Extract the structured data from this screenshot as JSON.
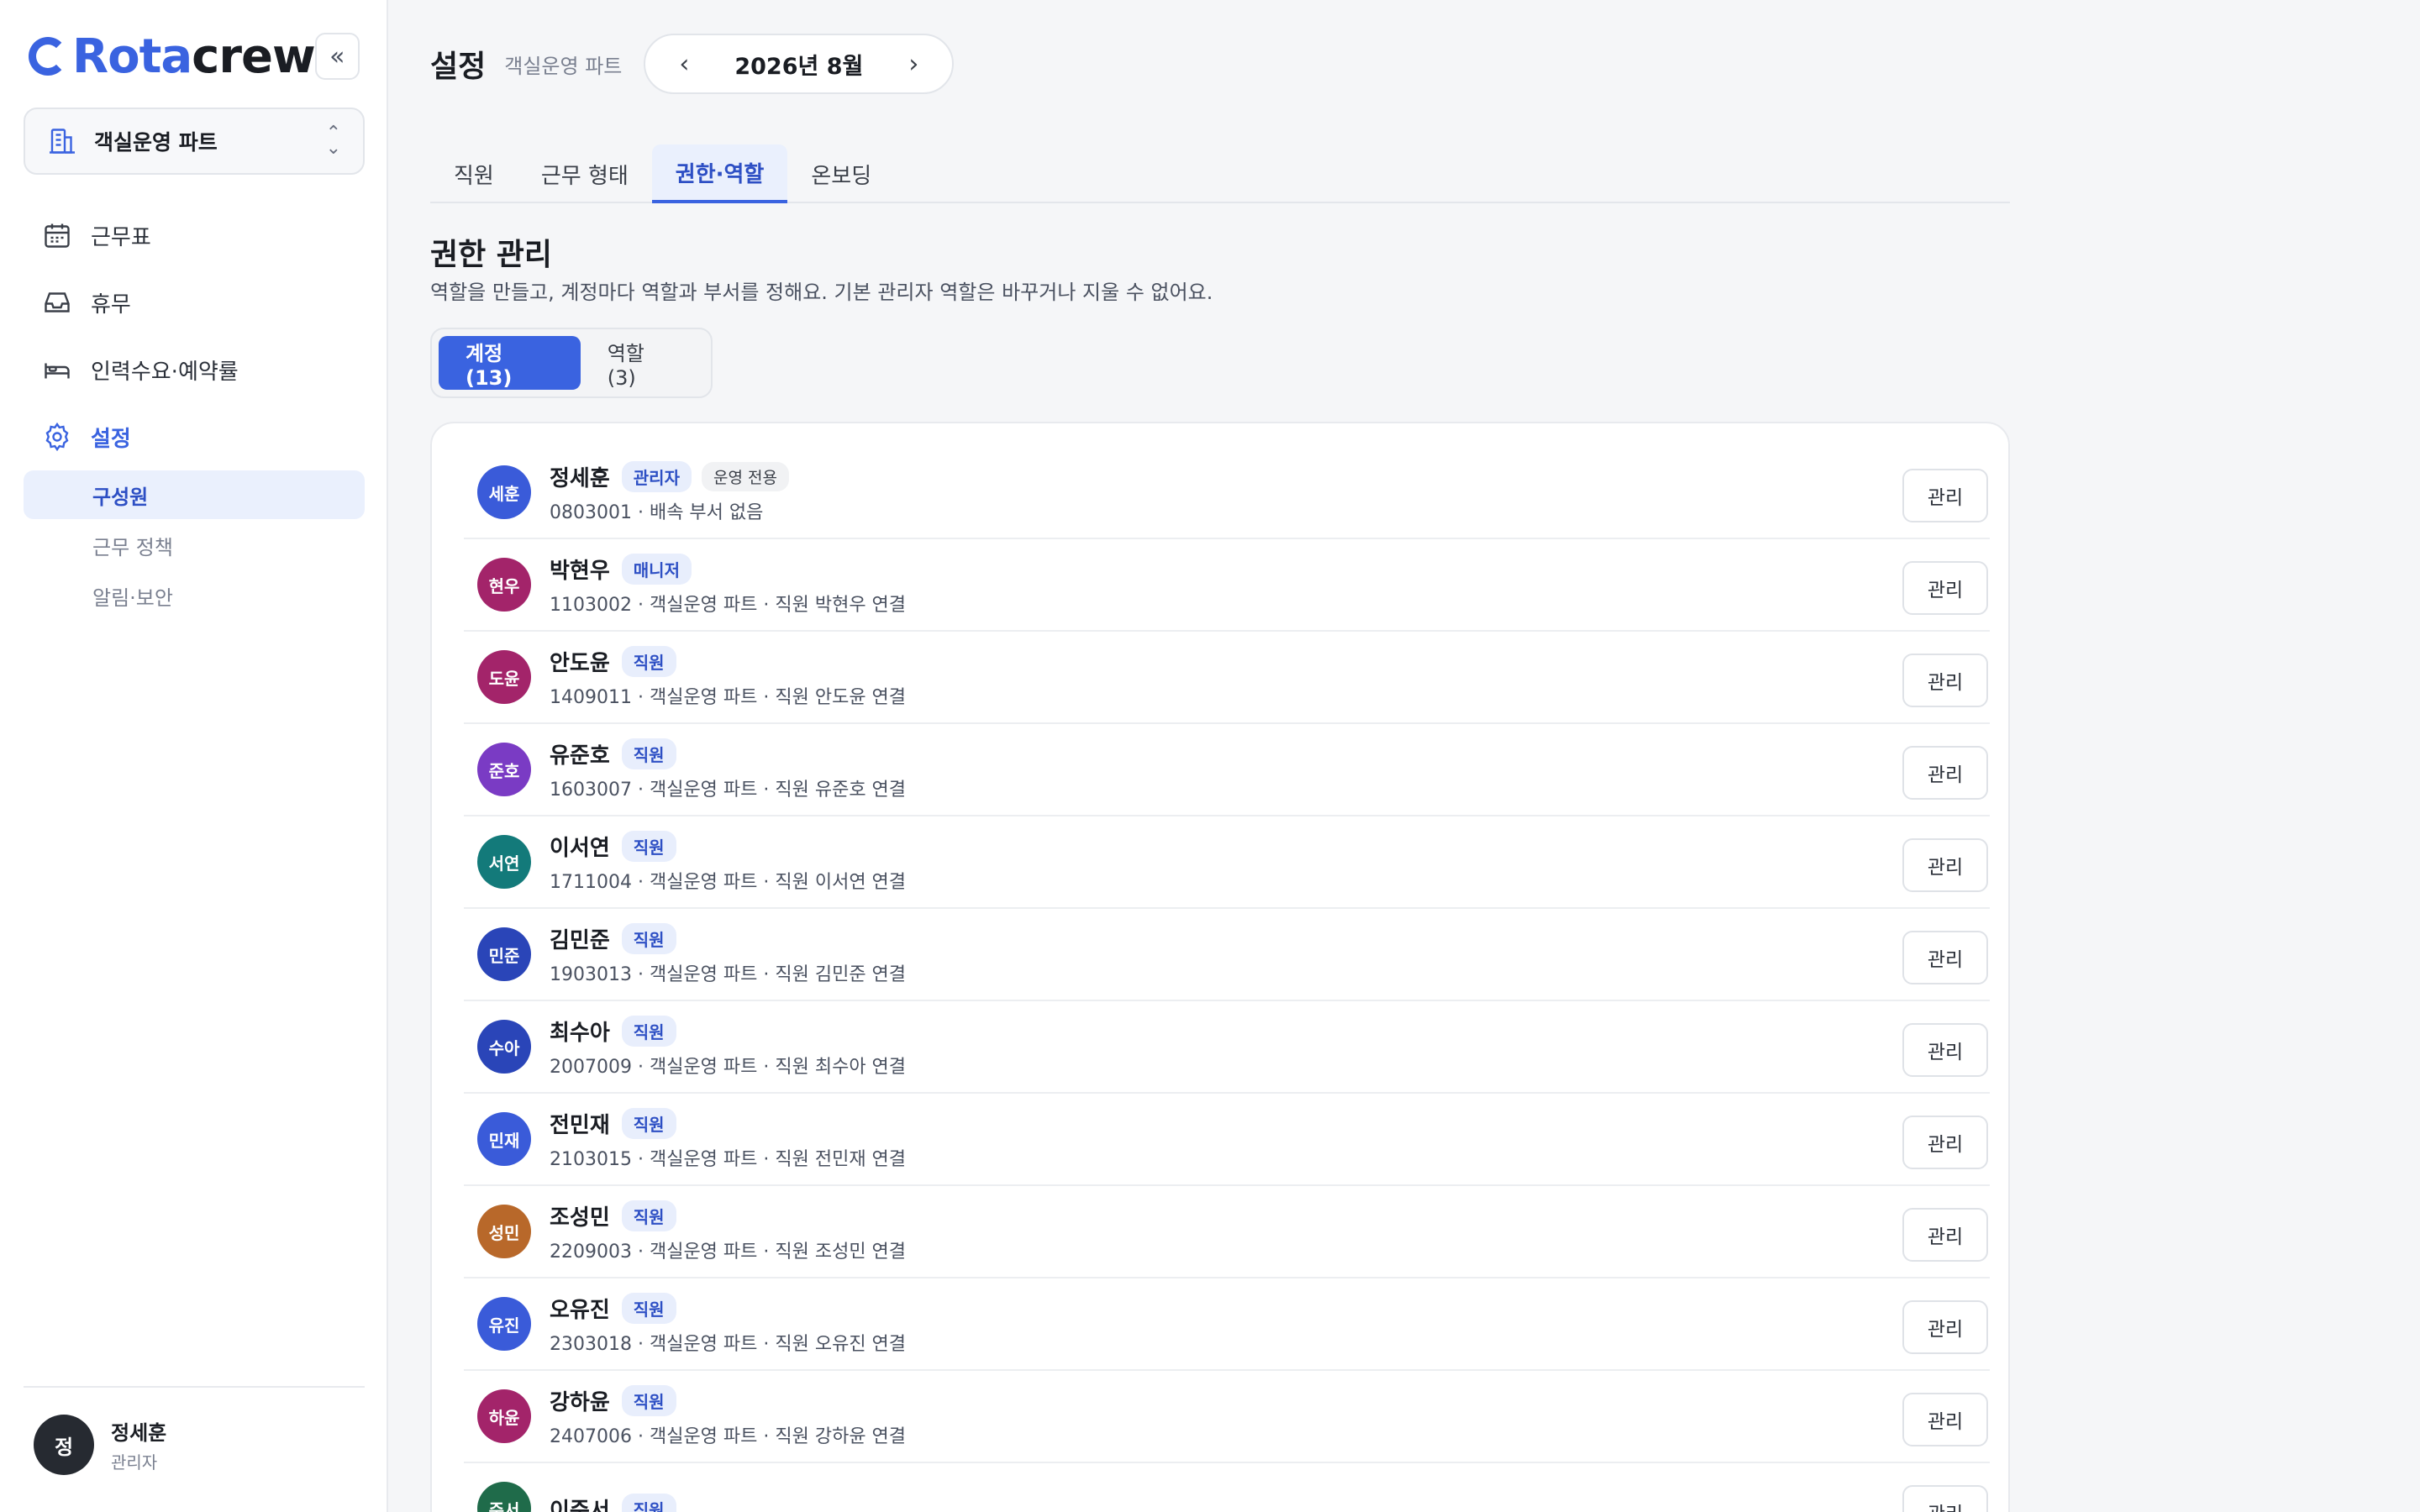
{
  "brand": {
    "part1": "Rota",
    "part2": "crew",
    "accent": "#3a63e0"
  },
  "sidebar": {
    "team": "객실운영 파트",
    "nav": [
      {
        "label": "근무표",
        "icon": "calendar-icon"
      },
      {
        "label": "휴무",
        "icon": "inbox-icon"
      },
      {
        "label": "인력수요·예약률",
        "icon": "bed-icon"
      },
      {
        "label": "설정",
        "icon": "gear-icon"
      }
    ],
    "sub": [
      {
        "label": "구성원"
      },
      {
        "label": "근무 정책"
      },
      {
        "label": "알림·보안"
      }
    ],
    "user": {
      "avatar": "정",
      "name": "정세훈",
      "role": "관리자"
    }
  },
  "header": {
    "title": "설정",
    "subtitle": "객실운영 파트",
    "month": "2026년 8월"
  },
  "tabs": [
    "직원",
    "근무 형태",
    "권한·역할",
    "온보딩"
  ],
  "section": {
    "title": "권한 관리",
    "desc": "역할을 만들고, 계정마다 역할과 부서를 정해요. 기본 관리자 역할은 바꾸거나 지울 수 없어요."
  },
  "segment": {
    "accounts": "계정 (13)",
    "roles": "역할 (3)"
  },
  "manage_label": "관리",
  "accounts": [
    {
      "avatar": "세훈",
      "color": "#3a5bd9",
      "name": "정세훈",
      "role": "관리자",
      "extra": "운영 전용",
      "detail": "0803001 · 배속 부서 없음"
    },
    {
      "avatar": "현우",
      "color": "#a3246a",
      "name": "박현우",
      "role": "매니저",
      "detail": "1103002 · 객실운영 파트 · 직원 박현우 연결"
    },
    {
      "avatar": "도윤",
      "color": "#a3246a",
      "name": "안도윤",
      "role": "직원",
      "detail": "1409011 · 객실운영 파트 · 직원 안도윤 연결"
    },
    {
      "avatar": "준호",
      "color": "#7a3bc4",
      "name": "유준호",
      "role": "직원",
      "detail": "1603007 · 객실운영 파트 · 직원 유준호 연결"
    },
    {
      "avatar": "서연",
      "color": "#137a7a",
      "name": "이서연",
      "role": "직원",
      "detail": "1711004 · 객실운영 파트 · 직원 이서연 연결"
    },
    {
      "avatar": "민준",
      "color": "#2a45b8",
      "name": "김민준",
      "role": "직원",
      "detail": "1903013 · 객실운영 파트 · 직원 김민준 연결"
    },
    {
      "avatar": "수아",
      "color": "#2a45b8",
      "name": "최수아",
      "role": "직원",
      "detail": "2007009 · 객실운영 파트 · 직원 최수아 연결"
    },
    {
      "avatar": "민재",
      "color": "#3a5bd9",
      "name": "전민재",
      "role": "직원",
      "detail": "2103015 · 객실운영 파트 · 직원 전민재 연결"
    },
    {
      "avatar": "성민",
      "color": "#b8682a",
      "name": "조성민",
      "role": "직원",
      "detail": "2209003 · 객실운영 파트 · 직원 조성민 연결"
    },
    {
      "avatar": "유진",
      "color": "#3a5bd9",
      "name": "오유진",
      "role": "직원",
      "detail": "2303018 · 객실운영 파트 · 직원 오유진 연결"
    },
    {
      "avatar": "하윤",
      "color": "#a3246a",
      "name": "강하윤",
      "role": "직원",
      "detail": "2407006 · 객실운영 파트 · 직원 강하윤 연결"
    },
    {
      "avatar": "준서",
      "color": "#1f6b4a",
      "name": "이준서",
      "role": "직원",
      "detail": ""
    }
  ]
}
